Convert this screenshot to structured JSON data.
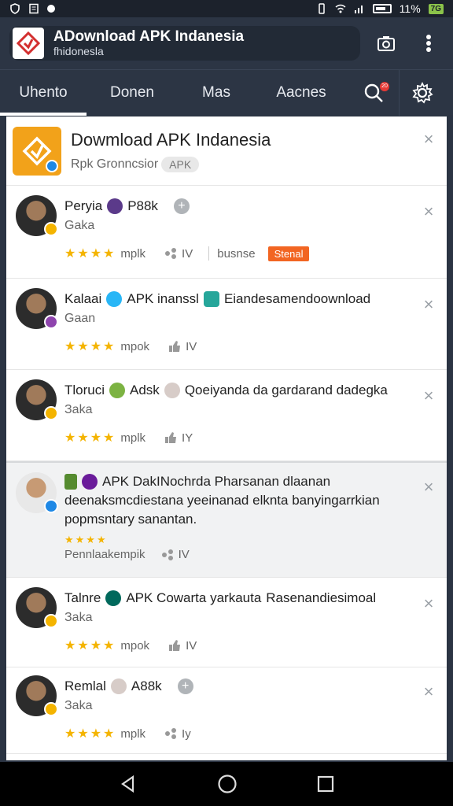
{
  "status": {
    "battery_text": "11%",
    "network": "7G"
  },
  "app_bar": {
    "title": "ADownload APK Indanesia",
    "subtitle": "fhidonesla"
  },
  "tabs": [
    {
      "label": "Uhento",
      "active": true
    },
    {
      "label": "Donen"
    },
    {
      "label": "Mas"
    },
    {
      "label": "Aacnes"
    }
  ],
  "search_badge": "20",
  "header_card": {
    "title": "Dowmload APK Indanesia",
    "subtitle": "Rpk Gronncsior",
    "pill": "APK"
  },
  "items": [
    {
      "name": "Peryia",
      "tail": "P88k",
      "sub": "Gaka",
      "stars": "★★★★",
      "rating_label": "mplk",
      "meta2": "IV",
      "extra": "busnse",
      "tag": "Stenal"
    },
    {
      "name": "Kalaai",
      "tail": "APK inanssl",
      "tail2": "Eiandesamendoownload",
      "sub": "Gaan",
      "stars": "★★★★",
      "rating_label": "mpok",
      "meta2": "IV"
    },
    {
      "name": "Tloruci",
      "tail": "Adsk",
      "tail2": "Qoeiyanda da gardarand dadegka",
      "sub": "Зaka",
      "stars": "★★★★",
      "rating_label": "mplk",
      "meta2": "IY"
    },
    {
      "name_line1": "APK DakINochrda Pharsanan dlaanan",
      "line2": "deenaksmcdiestana yeeinanad elknta banyingarrkian",
      "line3": "popmsntary sanantan.",
      "stars": "★★★★",
      "rating_label": "Pennlaakempik",
      "meta2": "IV"
    },
    {
      "name": "Talnre",
      "tail": "APK Cowarta yarkauta",
      "tail2": "Rasenandiesimoal",
      "sub": "Зaka",
      "stars": "★★★★",
      "rating_label": "mpok",
      "meta2": "IV"
    },
    {
      "name": "Remlal",
      "tail": "A88k",
      "sub": "Зaka",
      "stars": "★★★★",
      "rating_label": "mplk",
      "meta2": "Iy"
    }
  ]
}
